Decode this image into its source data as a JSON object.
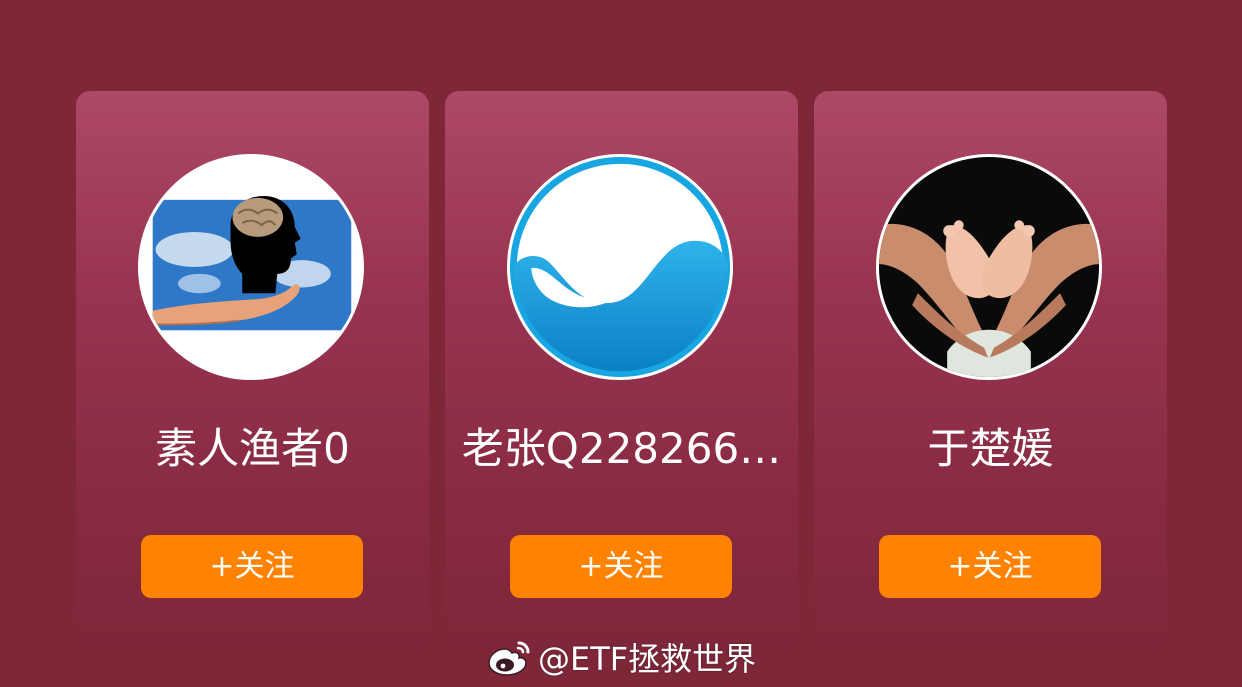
{
  "cards": [
    {
      "name": "素人渔者0",
      "follow_label": "+关注",
      "avatar_icon": "brain-head-in-hand-avatar"
    },
    {
      "name": "老张Q228266…",
      "follow_label": "+关注",
      "avatar_icon": "blue-wave-logo-avatar"
    },
    {
      "name": "于楚媛",
      "follow_label": "+关注",
      "avatar_icon": "baby-feet-hands-avatar"
    }
  ],
  "watermark": {
    "text": "@ETF拯救世界",
    "icon": "weibo-logo-icon"
  },
  "colors": {
    "background": "#7e2739",
    "card_top": "#ad4866",
    "follow_button": "#ff8200",
    "text": "#ffffff"
  }
}
